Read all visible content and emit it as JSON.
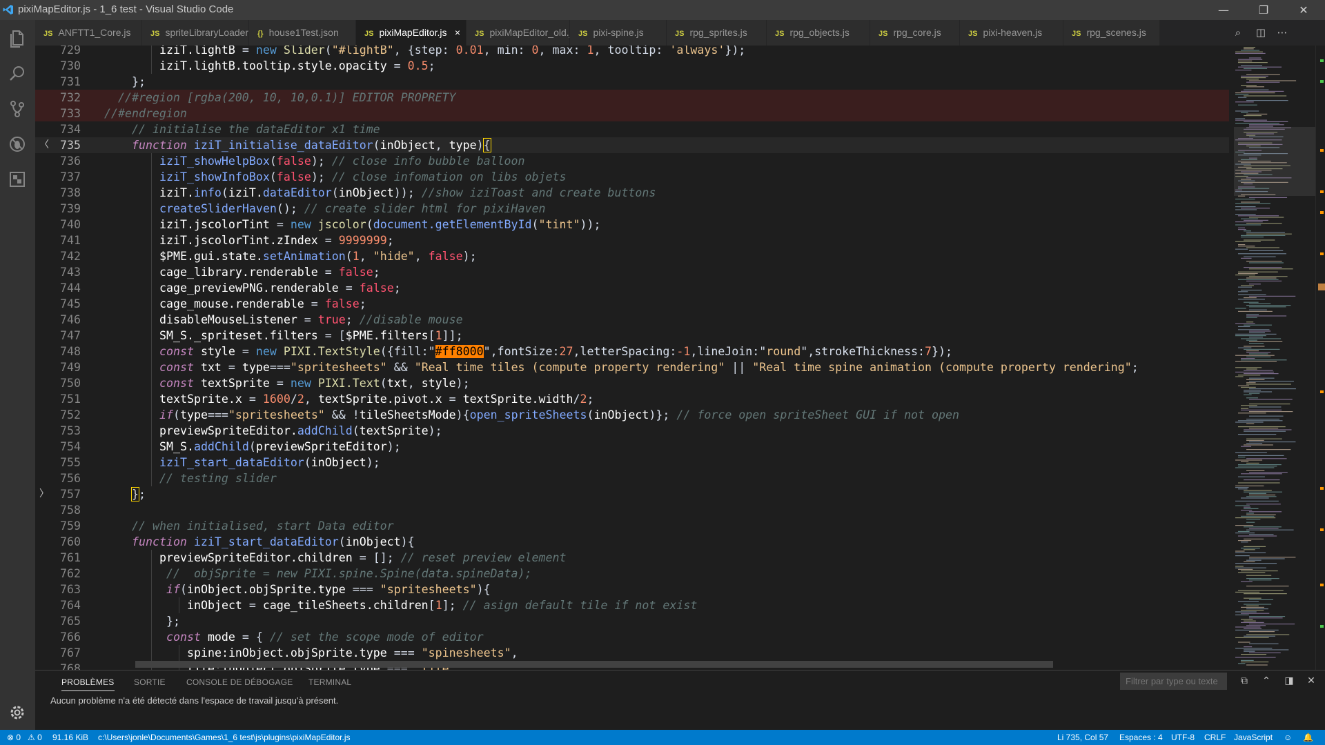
{
  "window": {
    "title": "pixiMapEditor.js - 1_6 test - Visual Studio Code",
    "minimize": "—",
    "restore": "❐",
    "close": "✕"
  },
  "tabs": [
    {
      "icon": "JS",
      "label": "ANFTT1_Core.js"
    },
    {
      "icon": "JS",
      "label": "spriteLibraryLoader.js"
    },
    {
      "icon": "{}",
      "label": "house1Test.json"
    },
    {
      "icon": "JS",
      "label": "pixiMapEditor.js",
      "active": true
    },
    {
      "icon": "JS",
      "label": "pixiMapEditor_old.js"
    },
    {
      "icon": "JS",
      "label": "pixi-spine.js"
    },
    {
      "icon": "JS",
      "label": "rpg_sprites.js"
    },
    {
      "icon": "JS",
      "label": "rpg_objects.js"
    },
    {
      "icon": "JS",
      "label": "rpg_core.js"
    },
    {
      "icon": "JS",
      "label": "pixi-heaven.js"
    },
    {
      "icon": "JS",
      "label": "rpg_scenes.js"
    }
  ],
  "tab_close_glyph": "×",
  "editor": {
    "lines": [
      {
        "n": "729",
        "indent": 2,
        "t": [
          [
            "v",
            "iziT.lightB "
          ],
          [
            "p",
            "= "
          ],
          [
            "kw",
            "new "
          ],
          [
            "f",
            "Slider"
          ],
          [
            "p",
            "("
          ],
          [
            "s",
            "\"#lightB\""
          ],
          [
            "p",
            ", {step: "
          ],
          [
            "n",
            "0.01"
          ],
          [
            "p",
            ", min: "
          ],
          [
            "n",
            "0"
          ],
          [
            "p",
            ", max: "
          ],
          [
            "n",
            "1"
          ],
          [
            "p",
            ", tooltip: "
          ],
          [
            "s",
            "'always'"
          ],
          [
            "p",
            "});"
          ]
        ]
      },
      {
        "n": "730",
        "indent": 2,
        "t": [
          [
            "v",
            "iziT.lightB.tooltip.style.opacity "
          ],
          [
            "p",
            "= "
          ],
          [
            "n",
            "0.5"
          ],
          [
            "p",
            ";"
          ]
        ]
      },
      {
        "n": "731",
        "indent": 1,
        "t": [
          [
            "p",
            "};"
          ]
        ]
      },
      {
        "n": "732",
        "indent": 0,
        "region": true,
        "t": [
          [
            "c",
            "  //#region [rgba(200, 10, 10,0.1)] EDITOR PROPRETY"
          ]
        ]
      },
      {
        "n": "733",
        "indent": 0,
        "region": true,
        "t": [
          [
            "c",
            "//#endregion"
          ]
        ]
      },
      {
        "n": "734",
        "indent": 1,
        "t": [
          [
            "c",
            "// initialise the dataEditor x1 time"
          ]
        ]
      },
      {
        "n": "735",
        "indent": 1,
        "current": true,
        "fold": "〈",
        "t": [
          [
            "k",
            "function "
          ],
          [
            "fn",
            "iziT_initialise_dataEditor"
          ],
          [
            "p",
            "("
          ],
          [
            "v",
            "inObject"
          ],
          [
            "p",
            ", "
          ],
          [
            "v",
            "type"
          ],
          [
            "p",
            ")"
          ],
          [
            "bm",
            "{"
          ]
        ]
      },
      {
        "n": "736",
        "indent": 2,
        "t": [
          [
            "fn",
            "iziT_showHelpBox"
          ],
          [
            "p",
            "("
          ],
          [
            "b",
            "false"
          ],
          [
            "p",
            "); "
          ],
          [
            "c",
            "// close info bubble balloon"
          ]
        ]
      },
      {
        "n": "737",
        "indent": 2,
        "t": [
          [
            "fn",
            "iziT_showInfoBox"
          ],
          [
            "p",
            "("
          ],
          [
            "b",
            "false"
          ],
          [
            "p",
            "); "
          ],
          [
            "c",
            "// close infomation on libs objets"
          ]
        ]
      },
      {
        "n": "738",
        "indent": 2,
        "t": [
          [
            "v",
            "iziT."
          ],
          [
            "fn",
            "info"
          ],
          [
            "p",
            "("
          ],
          [
            "v",
            "iziT."
          ],
          [
            "fn",
            "dataEditor"
          ],
          [
            "p",
            "("
          ],
          [
            "v",
            "inObject"
          ],
          [
            "p",
            "));"
          ],
          [
            "c",
            " //show iziToast and create buttons"
          ]
        ]
      },
      {
        "n": "739",
        "indent": 2,
        "t": [
          [
            "fn",
            "createSliderHaven"
          ],
          [
            "p",
            "(); "
          ],
          [
            "c",
            "// create slider html for pixiHaven"
          ]
        ]
      },
      {
        "n": "740",
        "indent": 2,
        "t": [
          [
            "v",
            "iziT.jscolorTint "
          ],
          [
            "p",
            "= "
          ],
          [
            "kw",
            "new "
          ],
          [
            "f",
            "jscolor"
          ],
          [
            "p",
            "("
          ],
          [
            "fn",
            "document.getElementById"
          ],
          [
            "p",
            "("
          ],
          [
            "s",
            "\"tint\""
          ],
          [
            "p",
            "));"
          ]
        ]
      },
      {
        "n": "741",
        "indent": 2,
        "t": [
          [
            "v",
            "iziT.jscolorTint.zIndex "
          ],
          [
            "p",
            "= "
          ],
          [
            "n",
            "9999999"
          ],
          [
            "p",
            ";"
          ]
        ]
      },
      {
        "n": "742",
        "indent": 2,
        "t": [
          [
            "v",
            "$PME.gui.state."
          ],
          [
            "fn",
            "setAnimation"
          ],
          [
            "p",
            "("
          ],
          [
            "n",
            "1"
          ],
          [
            "p",
            ", "
          ],
          [
            "s",
            "\"hide\""
          ],
          [
            "p",
            ", "
          ],
          [
            "b",
            "false"
          ],
          [
            "p",
            ");"
          ]
        ]
      },
      {
        "n": "743",
        "indent": 2,
        "t": [
          [
            "v",
            "cage_library.renderable "
          ],
          [
            "p",
            "= "
          ],
          [
            "b",
            "false"
          ],
          [
            "p",
            ";"
          ]
        ]
      },
      {
        "n": "744",
        "indent": 2,
        "t": [
          [
            "v",
            "cage_previewPNG.renderable "
          ],
          [
            "p",
            "= "
          ],
          [
            "b",
            "false"
          ],
          [
            "p",
            ";"
          ]
        ]
      },
      {
        "n": "745",
        "indent": 2,
        "t": [
          [
            "v",
            "cage_mouse.renderable "
          ],
          [
            "p",
            "= "
          ],
          [
            "b",
            "false"
          ],
          [
            "p",
            ";"
          ]
        ]
      },
      {
        "n": "746",
        "indent": 2,
        "t": [
          [
            "v",
            "disableMouseListener "
          ],
          [
            "p",
            "= "
          ],
          [
            "b",
            "true"
          ],
          [
            "p",
            "; "
          ],
          [
            "c",
            "//disable mouse"
          ]
        ]
      },
      {
        "n": "747",
        "indent": 2,
        "t": [
          [
            "v",
            "SM_S._spriteset.filters "
          ],
          [
            "p",
            "= ["
          ],
          [
            "v",
            "$PME.filters"
          ],
          [
            "p",
            "["
          ],
          [
            "n",
            "1"
          ],
          [
            "p",
            "]];"
          ]
        ]
      },
      {
        "n": "748",
        "indent": 2,
        "t": [
          [
            "k",
            "const "
          ],
          [
            "v",
            "style "
          ],
          [
            "p",
            "= "
          ],
          [
            "kw",
            "new "
          ],
          [
            "f",
            "PIXI.TextStyle"
          ],
          [
            "p",
            "({fill:\""
          ],
          [
            "hl",
            "#ff8000"
          ],
          [
            "p",
            "\",fontSize:"
          ],
          [
            "n",
            "27"
          ],
          [
            "p",
            ",letterSpacing:"
          ],
          [
            "n",
            "-1"
          ],
          [
            "p",
            ",lineJoin:\""
          ],
          [
            "s",
            "round"
          ],
          [
            "p",
            "\",strokeThickness:"
          ],
          [
            "n",
            "7"
          ],
          [
            "p",
            "});"
          ]
        ]
      },
      {
        "n": "749",
        "indent": 2,
        "t": [
          [
            "k",
            "const "
          ],
          [
            "v",
            "txt "
          ],
          [
            "p",
            "= "
          ],
          [
            "v",
            "type"
          ],
          [
            "p",
            "==="
          ],
          [
            "s",
            "\"spritesheets\""
          ],
          [
            "p",
            " && "
          ],
          [
            "s",
            "\"Real time tiles (compute property rendering\""
          ],
          [
            "p",
            " || "
          ],
          [
            "s",
            "\"Real time spine animation (compute property rendering\""
          ],
          [
            "p",
            ";"
          ]
        ]
      },
      {
        "n": "750",
        "indent": 2,
        "t": [
          [
            "k",
            "const "
          ],
          [
            "v",
            "textSprite "
          ],
          [
            "p",
            "= "
          ],
          [
            "kw",
            "new "
          ],
          [
            "f",
            "PIXI.Text"
          ],
          [
            "p",
            "("
          ],
          [
            "v",
            "txt"
          ],
          [
            "p",
            ", "
          ],
          [
            "v",
            "style"
          ],
          [
            "p",
            ");"
          ]
        ]
      },
      {
        "n": "751",
        "indent": 2,
        "t": [
          [
            "v",
            "textSprite.x "
          ],
          [
            "p",
            "= "
          ],
          [
            "n",
            "1600"
          ],
          [
            "p",
            "/"
          ],
          [
            "n",
            "2"
          ],
          [
            "p",
            ", "
          ],
          [
            "v",
            "textSprite.pivot.x "
          ],
          [
            "p",
            "= "
          ],
          [
            "v",
            "textSprite.width"
          ],
          [
            "p",
            "/"
          ],
          [
            "n",
            "2"
          ],
          [
            "p",
            ";"
          ]
        ]
      },
      {
        "n": "752",
        "indent": 2,
        "t": [
          [
            "k",
            "if"
          ],
          [
            "p",
            "("
          ],
          [
            "v",
            "type"
          ],
          [
            "p",
            "==="
          ],
          [
            "s",
            "\"spritesheets\""
          ],
          [
            "p",
            " && !"
          ],
          [
            "v",
            "tileSheetsMode"
          ],
          [
            "p",
            ")"
          ],
          [
            "p",
            "{"
          ],
          [
            "fn",
            "open_spriteSheets"
          ],
          [
            "p",
            "("
          ],
          [
            "v",
            "inObject"
          ],
          [
            "p",
            ")}; "
          ],
          [
            "c",
            "// force open spriteSheet GUI if not open"
          ]
        ]
      },
      {
        "n": "753",
        "indent": 2,
        "t": [
          [
            "v",
            "previewSpriteEditor."
          ],
          [
            "fn",
            "addChild"
          ],
          [
            "p",
            "("
          ],
          [
            "v",
            "textSprite"
          ],
          [
            "p",
            ");"
          ]
        ]
      },
      {
        "n": "754",
        "indent": 2,
        "t": [
          [
            "v",
            "SM_S."
          ],
          [
            "fn",
            "addChild"
          ],
          [
            "p",
            "("
          ],
          [
            "v",
            "previewSpriteEditor"
          ],
          [
            "p",
            ");"
          ]
        ]
      },
      {
        "n": "755",
        "indent": 2,
        "t": [
          [
            "fn",
            "iziT_start_dataEditor"
          ],
          [
            "p",
            "("
          ],
          [
            "v",
            "inObject"
          ],
          [
            "p",
            ");"
          ]
        ]
      },
      {
        "n": "756",
        "indent": 2,
        "t": [
          [
            "c",
            "// testing slider"
          ]
        ]
      },
      {
        "n": "757",
        "indent": 1,
        "fold": "〉",
        "t": [
          [
            "bm",
            "}"
          ],
          [
            "p",
            ";"
          ]
        ]
      },
      {
        "n": "758",
        "indent": 0,
        "t": []
      },
      {
        "n": "759",
        "indent": 1,
        "t": [
          [
            "c",
            "// when initialised, start Data editor"
          ]
        ]
      },
      {
        "n": "760",
        "indent": 1,
        "t": [
          [
            "k",
            "function "
          ],
          [
            "fn",
            "iziT_start_dataEditor"
          ],
          [
            "p",
            "("
          ],
          [
            "v",
            "inObject"
          ],
          [
            "p",
            "){"
          ]
        ]
      },
      {
        "n": "761",
        "indent": 2,
        "t": [
          [
            "v",
            "previewSpriteEditor.children "
          ],
          [
            "p",
            "= []; "
          ],
          [
            "c",
            "// reset preview element"
          ]
        ]
      },
      {
        "n": "762",
        "indent": 2,
        "t": [
          [
            "c",
            " //  objSprite = new PIXI.spine.Spine(data.spineData);"
          ]
        ]
      },
      {
        "n": "763",
        "indent": 2,
        "t": [
          [
            "k",
            " if"
          ],
          [
            "p",
            "("
          ],
          [
            "v",
            "inObject.objSprite.type "
          ],
          [
            "p",
            "=== "
          ],
          [
            "s",
            "\"spritesheets\""
          ],
          [
            "p",
            "){"
          ]
        ]
      },
      {
        "n": "764",
        "indent": 3,
        "t": [
          [
            "v",
            "inObject "
          ],
          [
            "p",
            "= "
          ],
          [
            "v",
            "cage_tileSheets.children"
          ],
          [
            "p",
            "["
          ],
          [
            "n",
            "1"
          ],
          [
            "p",
            "]; "
          ],
          [
            "c",
            "// asign default tile if not exist"
          ]
        ]
      },
      {
        "n": "765",
        "indent": 2,
        "t": [
          [
            "p",
            " };"
          ]
        ]
      },
      {
        "n": "766",
        "indent": 2,
        "t": [
          [
            "k",
            " const "
          ],
          [
            "v",
            "mode "
          ],
          [
            "p",
            "= { "
          ],
          [
            "c",
            "// set the scope mode of editor"
          ]
        ]
      },
      {
        "n": "767",
        "indent": 3,
        "t": [
          [
            "v",
            "spine:inObject.objSprite.type "
          ],
          [
            "p",
            "=== "
          ],
          [
            "s",
            "\"spinesheets\""
          ],
          [
            "p",
            ","
          ]
        ]
      },
      {
        "n": "768",
        "indent": 3,
        "t": [
          [
            "v",
            "tile:inObject.objSprite.type "
          ],
          [
            "p",
            "=== "
          ],
          [
            "s",
            "\"tile\""
          ]
        ]
      }
    ]
  },
  "panel": {
    "tabs": [
      "PROBLÈMES",
      "SORTIE",
      "CONSOLE DE DÉBOGAGE",
      "TERMINAL"
    ],
    "filter_placeholder": "Filtrer par type ou texte",
    "message": "Aucun problème n'a été détecté dans l'espace de travail jusqu'à présent."
  },
  "statusbar": {
    "errors": "⊗ 0",
    "warnings": "⚠ 0",
    "size": "91.16 KiB",
    "path": "c:\\Users\\jonle\\Documents\\Games\\1_6 test\\js\\plugins\\pixiMapEditor.js",
    "position": "Li 735, Col 57",
    "spaces": "Espaces : 4",
    "encoding": "UTF-8",
    "eol": "CRLF",
    "language": "JavaScript"
  },
  "colors": {
    "statusbar": "#007acc",
    "titlebar": "#3c3c3c",
    "editor_bg": "#1e1e1e",
    "highlight": "#ff8000"
  }
}
